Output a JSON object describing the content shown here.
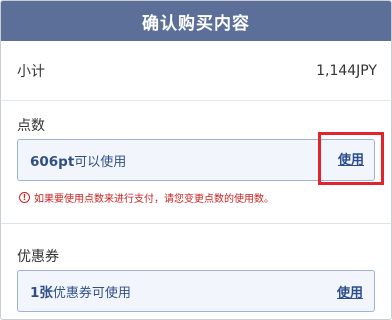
{
  "header": {
    "title": "确认购买内容"
  },
  "subtotal": {
    "label": "小计",
    "value": "1,144JPY"
  },
  "points": {
    "label": "点数",
    "amount": "606pt",
    "suffix": "可以使用",
    "use_label": "使用",
    "warning_icon": "!",
    "warning": "如果要使用点数来进行支付，请您变更点数的使用数。"
  },
  "coupon": {
    "label": "优惠券",
    "amount": "1张",
    "suffix": "优惠券可使用",
    "use_label": "使用"
  },
  "colors": {
    "header_bg": "#5b6f99",
    "box_bg": "#f2f6fc",
    "box_border": "#9fb3d6",
    "link": "#2b4d8c",
    "warning": "#cc2222",
    "highlight": "#e1252a"
  }
}
